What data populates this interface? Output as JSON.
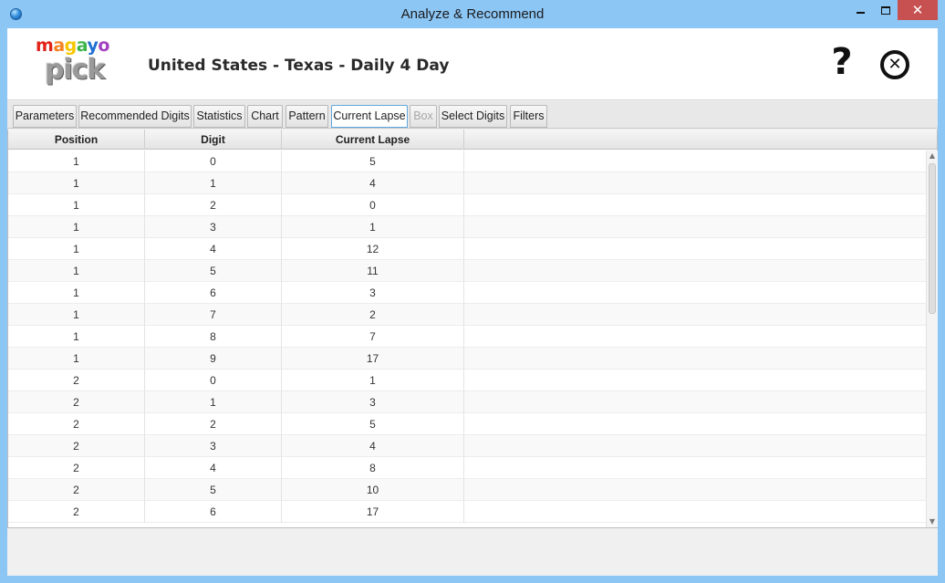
{
  "window": {
    "title": "Analyze & Recommend",
    "icon": "app-orb-icon"
  },
  "header": {
    "logo_top": "magayo",
    "logo_bottom": "pick",
    "lottery_title": "United States - Texas - Daily 4 Day",
    "help_icon": "help-icon",
    "close_icon": "close-circle-icon"
  },
  "tabs": [
    {
      "label": "Parameters"
    },
    {
      "label": "Recommended Digits"
    },
    {
      "label": "Statistics"
    },
    {
      "label": "Chart"
    },
    {
      "label": "Pattern"
    },
    {
      "label": "Current Lapse",
      "active": true
    },
    {
      "label": "Box",
      "disabled": true
    },
    {
      "label": "Select Digits"
    },
    {
      "label": "Filters"
    }
  ],
  "table": {
    "columns": [
      "Position",
      "Digit",
      "Current Lapse",
      ""
    ],
    "rows": [
      [
        "1",
        "0",
        "5"
      ],
      [
        "1",
        "1",
        "4"
      ],
      [
        "1",
        "2",
        "0"
      ],
      [
        "1",
        "3",
        "1"
      ],
      [
        "1",
        "4",
        "12"
      ],
      [
        "1",
        "5",
        "11"
      ],
      [
        "1",
        "6",
        "3"
      ],
      [
        "1",
        "7",
        "2"
      ],
      [
        "1",
        "8",
        "7"
      ],
      [
        "1",
        "9",
        "17"
      ],
      [
        "2",
        "0",
        "1"
      ],
      [
        "2",
        "1",
        "3"
      ],
      [
        "2",
        "2",
        "5"
      ],
      [
        "2",
        "3",
        "4"
      ],
      [
        "2",
        "4",
        "8"
      ],
      [
        "2",
        "5",
        "10"
      ],
      [
        "2",
        "6",
        "17"
      ]
    ]
  },
  "colors": {
    "titlebar": "#8cc6f5",
    "active_tab_border": "#60a8de",
    "close_button": "#c75050"
  }
}
